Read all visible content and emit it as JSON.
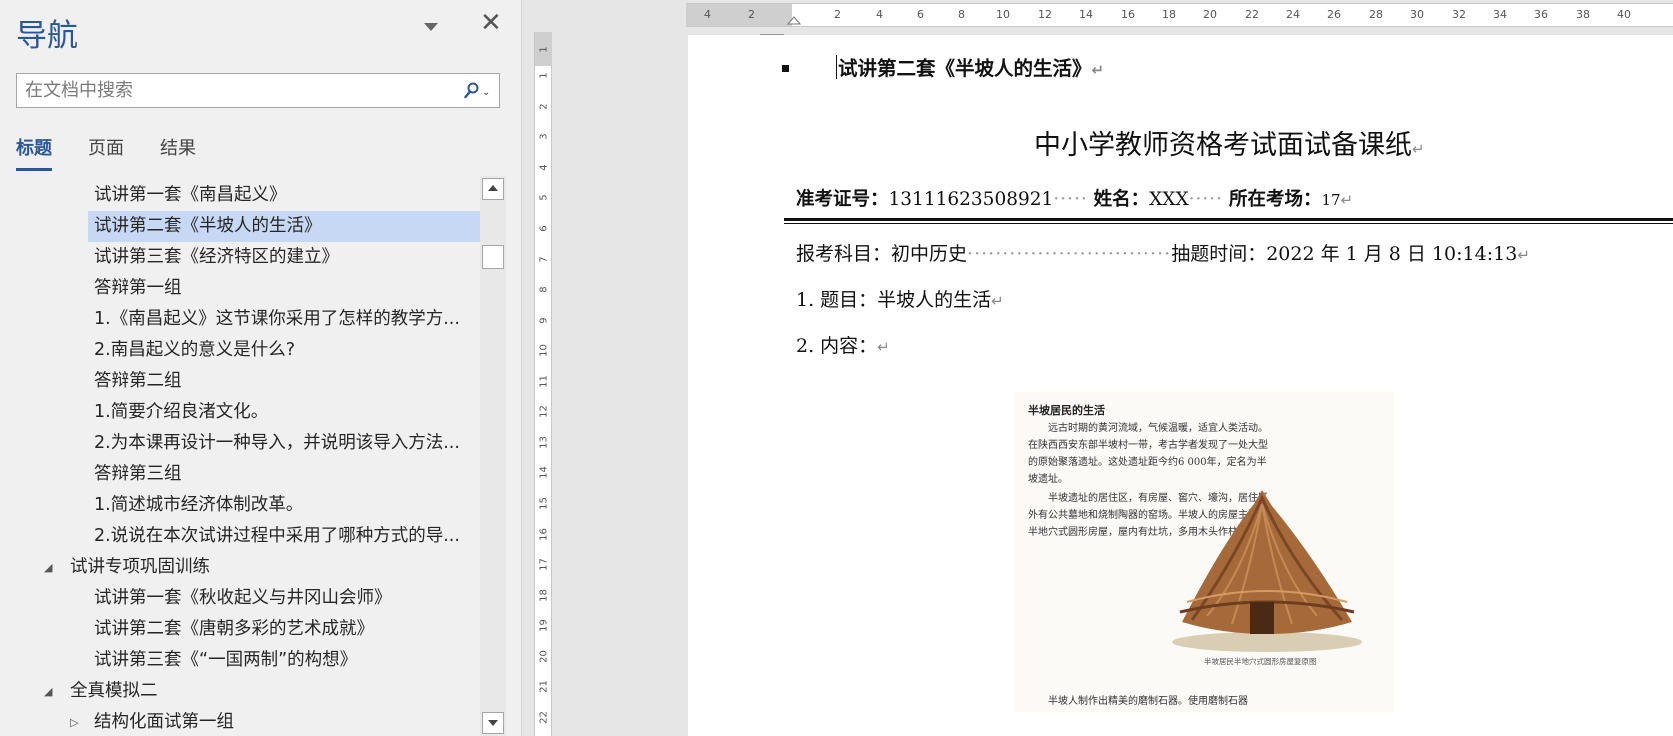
{
  "nav": {
    "title": "导航",
    "close_glyph": "✕",
    "search_placeholder": "在文档中搜索",
    "tabs": [
      "标题",
      "页面",
      "结果"
    ],
    "active_tab": "标题",
    "items": [
      {
        "label": "试讲第一套《南昌起义》",
        "level": 2
      },
      {
        "label": "试讲第二套《半坡人的生活》",
        "level": 2,
        "selected": true
      },
      {
        "label": "试讲第三套《经济特区的建立》",
        "level": 2
      },
      {
        "label": "答辩第一组",
        "level": 2
      },
      {
        "label": "1.《南昌起义》这节课你采用了怎样的教学方...",
        "level": 2
      },
      {
        "label": "2.南昌起义的意义是什么?",
        "level": 2
      },
      {
        "label": "答辩第二组",
        "level": 2
      },
      {
        "label": "1.简要介绍良渚文化。",
        "level": 2
      },
      {
        "label": "2.为本课再设计一种导入，并说明该导入方法...",
        "level": 2
      },
      {
        "label": "答辩第三组",
        "level": 2
      },
      {
        "label": "1.简述城市经济体制改革。",
        "level": 2
      },
      {
        "label": "2.说说在本次试讲过程中采用了哪种方式的导...",
        "level": 2
      },
      {
        "label": "试讲专项巩固训练",
        "level": 1,
        "expander": "expanded"
      },
      {
        "label": "试讲第一套《秋收起义与井冈山会师》",
        "level": 2
      },
      {
        "label": "试讲第二套《唐朝多彩的艺术成就》",
        "level": 2
      },
      {
        "label": "试讲第三套《“一国两制”的构想》",
        "level": 2
      },
      {
        "label": "全真模拟二",
        "level": 1,
        "expander": "expanded"
      },
      {
        "label": "结构化面试第一组",
        "level": 2,
        "expander": "collapsed"
      }
    ]
  },
  "rulers": {
    "horizontal": [
      "4",
      "2",
      "2",
      "4",
      "6",
      "8",
      "10",
      "12",
      "14",
      "16",
      "18",
      "20",
      "22",
      "24",
      "26",
      "28",
      "30",
      "32",
      "34",
      "36",
      "38",
      "40"
    ],
    "vertical": [
      "1",
      "1",
      "2",
      "3",
      "4",
      "5",
      "6",
      "7",
      "8",
      "9",
      "10",
      "11",
      "12",
      "13",
      "14",
      "15",
      "16",
      "17",
      "18",
      "19",
      "20",
      "21",
      "22"
    ]
  },
  "document": {
    "heading": "试讲第二套《半坡人的生活》",
    "form_title": "中小学教师资格考试面试备课纸",
    "exam_no_label": "准考证号：",
    "exam_no": "13111623508921",
    "name_label": "姓名：",
    "name": "XXX",
    "venue_label": "所在考场：",
    "venue": "17",
    "subject_label": "报考科目：",
    "subject": "初中历史",
    "draw_time_label": "抽题时间：",
    "draw_time": "2022 年 1 月 8 日 10:14:13",
    "topic": "1. 题目：半坡人的生活",
    "content": "2. 内容：",
    "para_mark": "↵",
    "textbook": {
      "title": "半坡居民的生活",
      "para1": "远古时期的黄河流域，气候温暖，适宜人类活动。在陕西西安东部半坡村一带，考古学者发现了一处大型的原始聚落遗址。这处遗址距今约6 000年，定名为半坡遗址。",
      "para2": "半坡遗址的居住区，有房屋、窖穴、壕沟，居住区外有公共墓地和烧制陶器的窑场。半坡人的房屋主要是半地穴式圆形房屋，屋内有灶坑，多用木头作柱子。",
      "caption": "半坡居民半地穴式圆形房屋复原图",
      "para3": "半坡人制作出精美的磨制石器。使用磨制石器"
    }
  }
}
